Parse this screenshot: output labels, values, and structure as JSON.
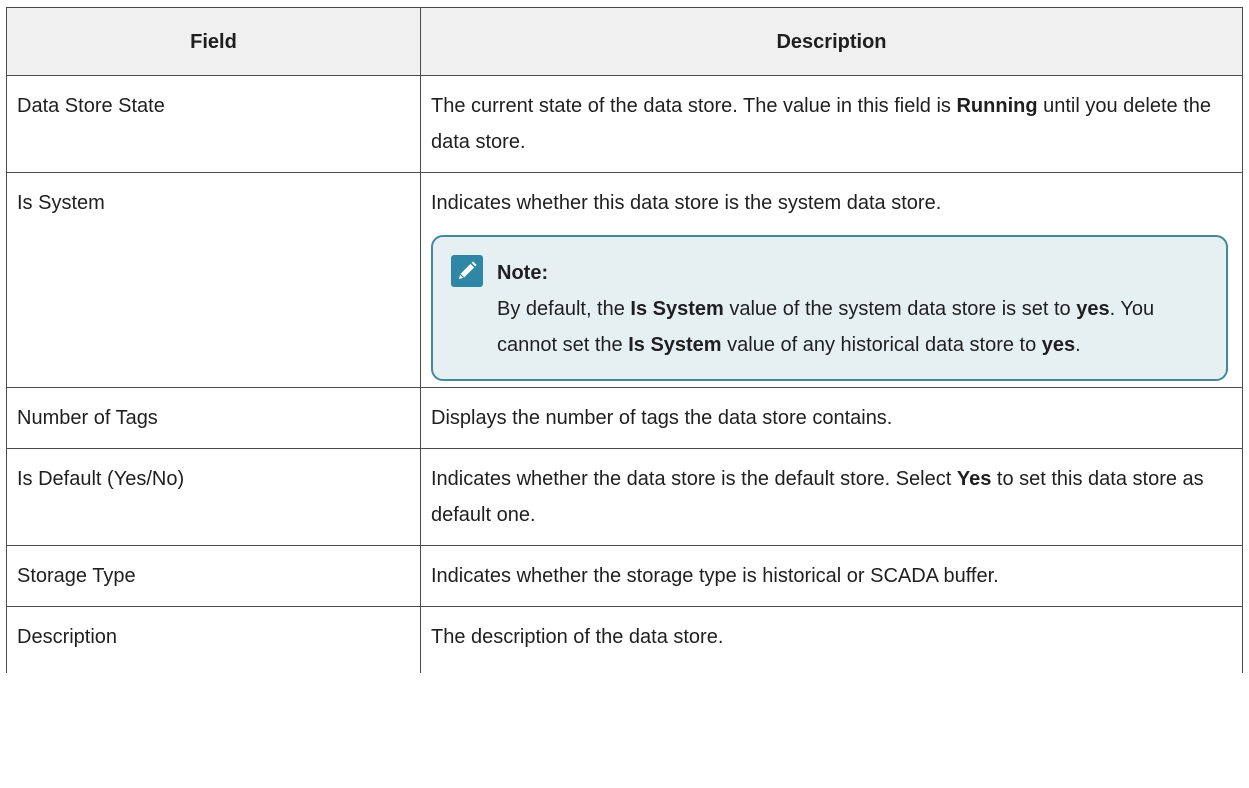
{
  "table": {
    "headers": {
      "field": "Field",
      "description": "Description"
    },
    "rows": [
      {
        "field": "Data Store State",
        "desc": [
          {
            "t": "The current state of the data store. The value in this field is "
          },
          {
            "t": "Running",
            "b": true
          },
          {
            "t": " until you delete the data store."
          }
        ]
      },
      {
        "field": "Is System",
        "desc": [
          {
            "t": "Indicates whether this data store is the system data store."
          }
        ],
        "note": {
          "title": "Note:",
          "icon": "pencil-icon",
          "body": [
            {
              "t": "By default, the "
            },
            {
              "t": "Is System",
              "b": true
            },
            {
              "t": " value of the system data store is set to "
            },
            {
              "t": "yes",
              "b": true
            },
            {
              "t": ". You cannot set the "
            },
            {
              "t": "Is System",
              "b": true
            },
            {
              "t": " value of any histori­cal data store to "
            },
            {
              "t": "yes",
              "b": true
            },
            {
              "t": "."
            }
          ]
        }
      },
      {
        "field": "Number of Tags",
        "desc": [
          {
            "t": "Displays the number of tags the data store contains."
          }
        ]
      },
      {
        "field": "Is Default (Yes/No)",
        "desc": [
          {
            "t": "Indicates whether the data store is the default store. Select "
          },
          {
            "t": "Yes",
            "b": true
          },
          {
            "t": " to set this data store as default one."
          }
        ]
      },
      {
        "field": "Storage Type",
        "desc": [
          {
            "t": "Indicates whether the storage type is historical or SCADA buffer."
          }
        ]
      },
      {
        "field": "Description",
        "desc": [
          {
            "t": "The description of the data store."
          }
        ]
      }
    ]
  },
  "colors": {
    "note_border": "#44879e",
    "note_background": "#e6f0f3",
    "note_icon": "#2f87a5",
    "header_background": "#f0f0f0"
  }
}
